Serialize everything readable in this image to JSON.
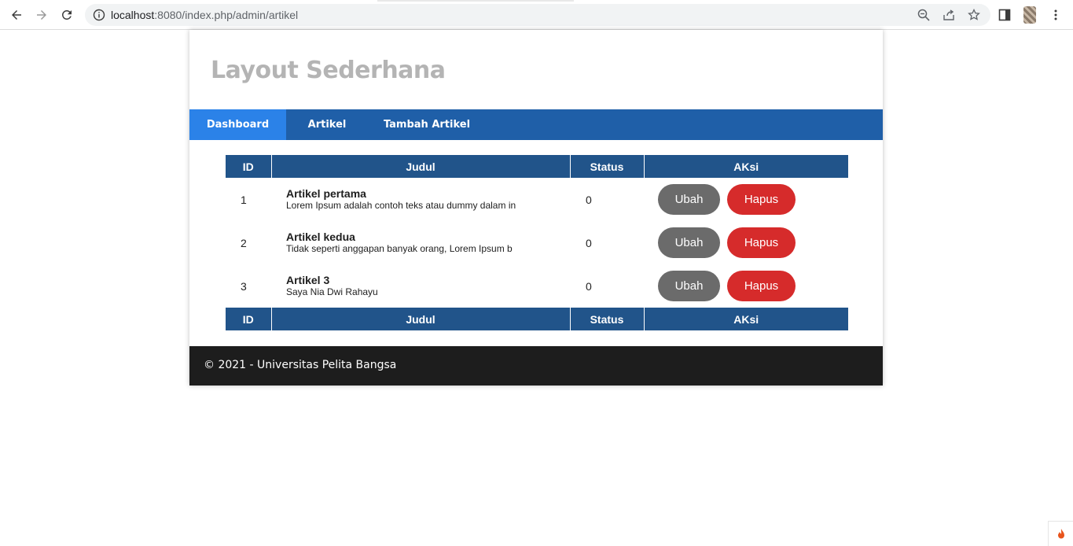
{
  "browser": {
    "url_host": "localhost",
    "url_rest": ":8080/index.php/admin/artikel"
  },
  "site": {
    "title": "Layout Sederhana"
  },
  "nav": {
    "items": [
      {
        "label": "Dashboard",
        "active": true
      },
      {
        "label": "Artikel",
        "active": false
      },
      {
        "label": "Tambah Artikel",
        "active": false
      }
    ]
  },
  "table": {
    "headers": [
      "ID",
      "Judul",
      "Status",
      "AKsi"
    ],
    "rows": [
      {
        "id": "1",
        "title": "Artikel pertama",
        "excerpt": "Lorem Ipsum adalah contoh teks atau dummy dalam in",
        "status": "0"
      },
      {
        "id": "2",
        "title": "Artikel kedua",
        "excerpt": "Tidak seperti anggapan banyak orang, Lorem Ipsum b",
        "status": "0"
      },
      {
        "id": "3",
        "title": "Artikel 3",
        "excerpt": "Saya Nia Dwi Rahayu",
        "status": "0"
      }
    ],
    "edit_label": "Ubah",
    "delete_label": "Hapus"
  },
  "footer": {
    "text": "© 2021 - Universitas Pelita Bangsa"
  },
  "colors": {
    "nav": "#1f5fa8",
    "nav_active": "#2b82e8",
    "table_header": "#21548a",
    "btn_edit": "#6b6b6b",
    "btn_delete": "#d62b2b",
    "footer": "#1d1d1d"
  }
}
